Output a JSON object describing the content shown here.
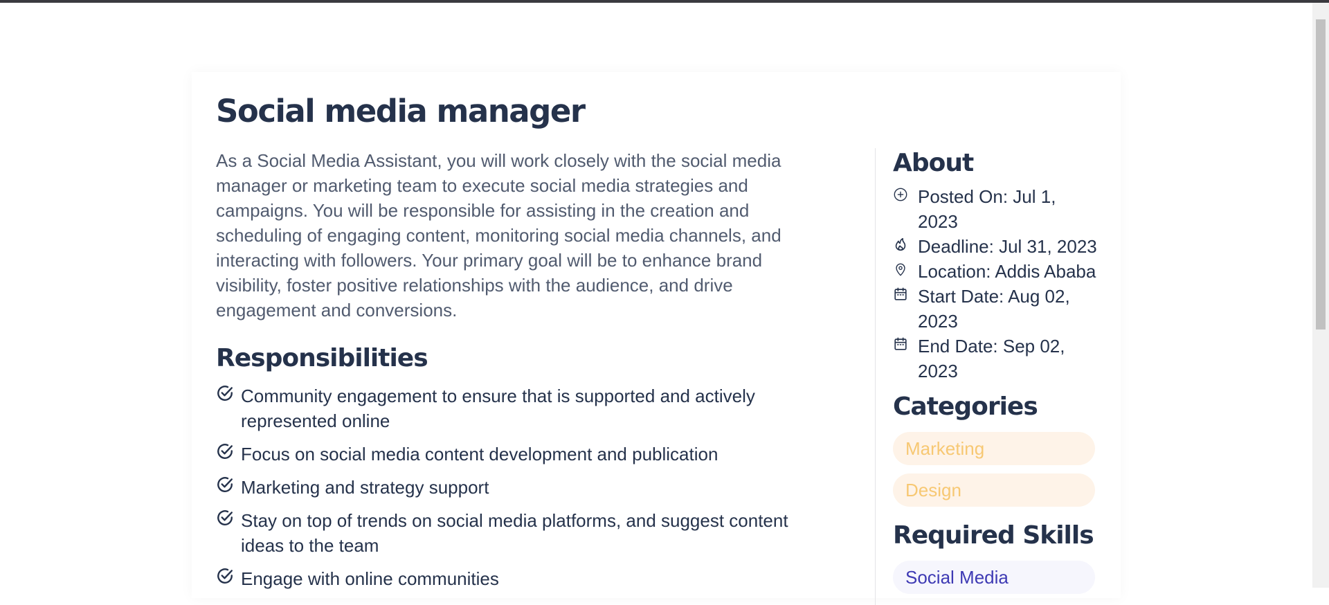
{
  "job": {
    "title": "Social media manager",
    "description": "As a Social Media Assistant, you will work closely with the social media manager or marketing team to execute social media strategies and campaigns. You will be responsible for assisting in the creation and scheduling of engaging content, monitoring social media channels, and interacting with followers. Your primary goal will be to enhance brand visibility, foster positive relationships with the audience, and drive engagement and conversions."
  },
  "responsibilities": {
    "heading": "Responsibilities",
    "items": [
      "Community engagement to ensure that is supported and actively represented online",
      "Focus on social media content development and publication",
      "Marketing and strategy support",
      "Stay on top of trends on social media platforms, and suggest content ideas to the team",
      "Engage with online communities"
    ]
  },
  "about": {
    "heading": "About",
    "items": [
      {
        "icon": "plus-circle-icon",
        "text": "Posted On: Jul 1, 2023"
      },
      {
        "icon": "fire-icon",
        "text": "Deadline: Jul 31, 2023"
      },
      {
        "icon": "location-pin-icon",
        "text": "Location: Addis Ababa"
      },
      {
        "icon": "calendar-icon",
        "text": "Start Date: Aug 02, 2023"
      },
      {
        "icon": "calendar-icon",
        "text": "End Date: Sep 02, 2023"
      }
    ]
  },
  "categories": {
    "heading": "Categories",
    "items": [
      "Marketing",
      "Design"
    ]
  },
  "skills": {
    "heading": "Required Skills",
    "items": [
      "Social Media"
    ]
  },
  "colors": {
    "heading": "#25324b",
    "body_text": "#515b6f",
    "category_bg": "#fef3e8",
    "category_text": "#f7c873",
    "skill_bg": "#f6f6fd",
    "skill_text": "#3e3ab4"
  }
}
